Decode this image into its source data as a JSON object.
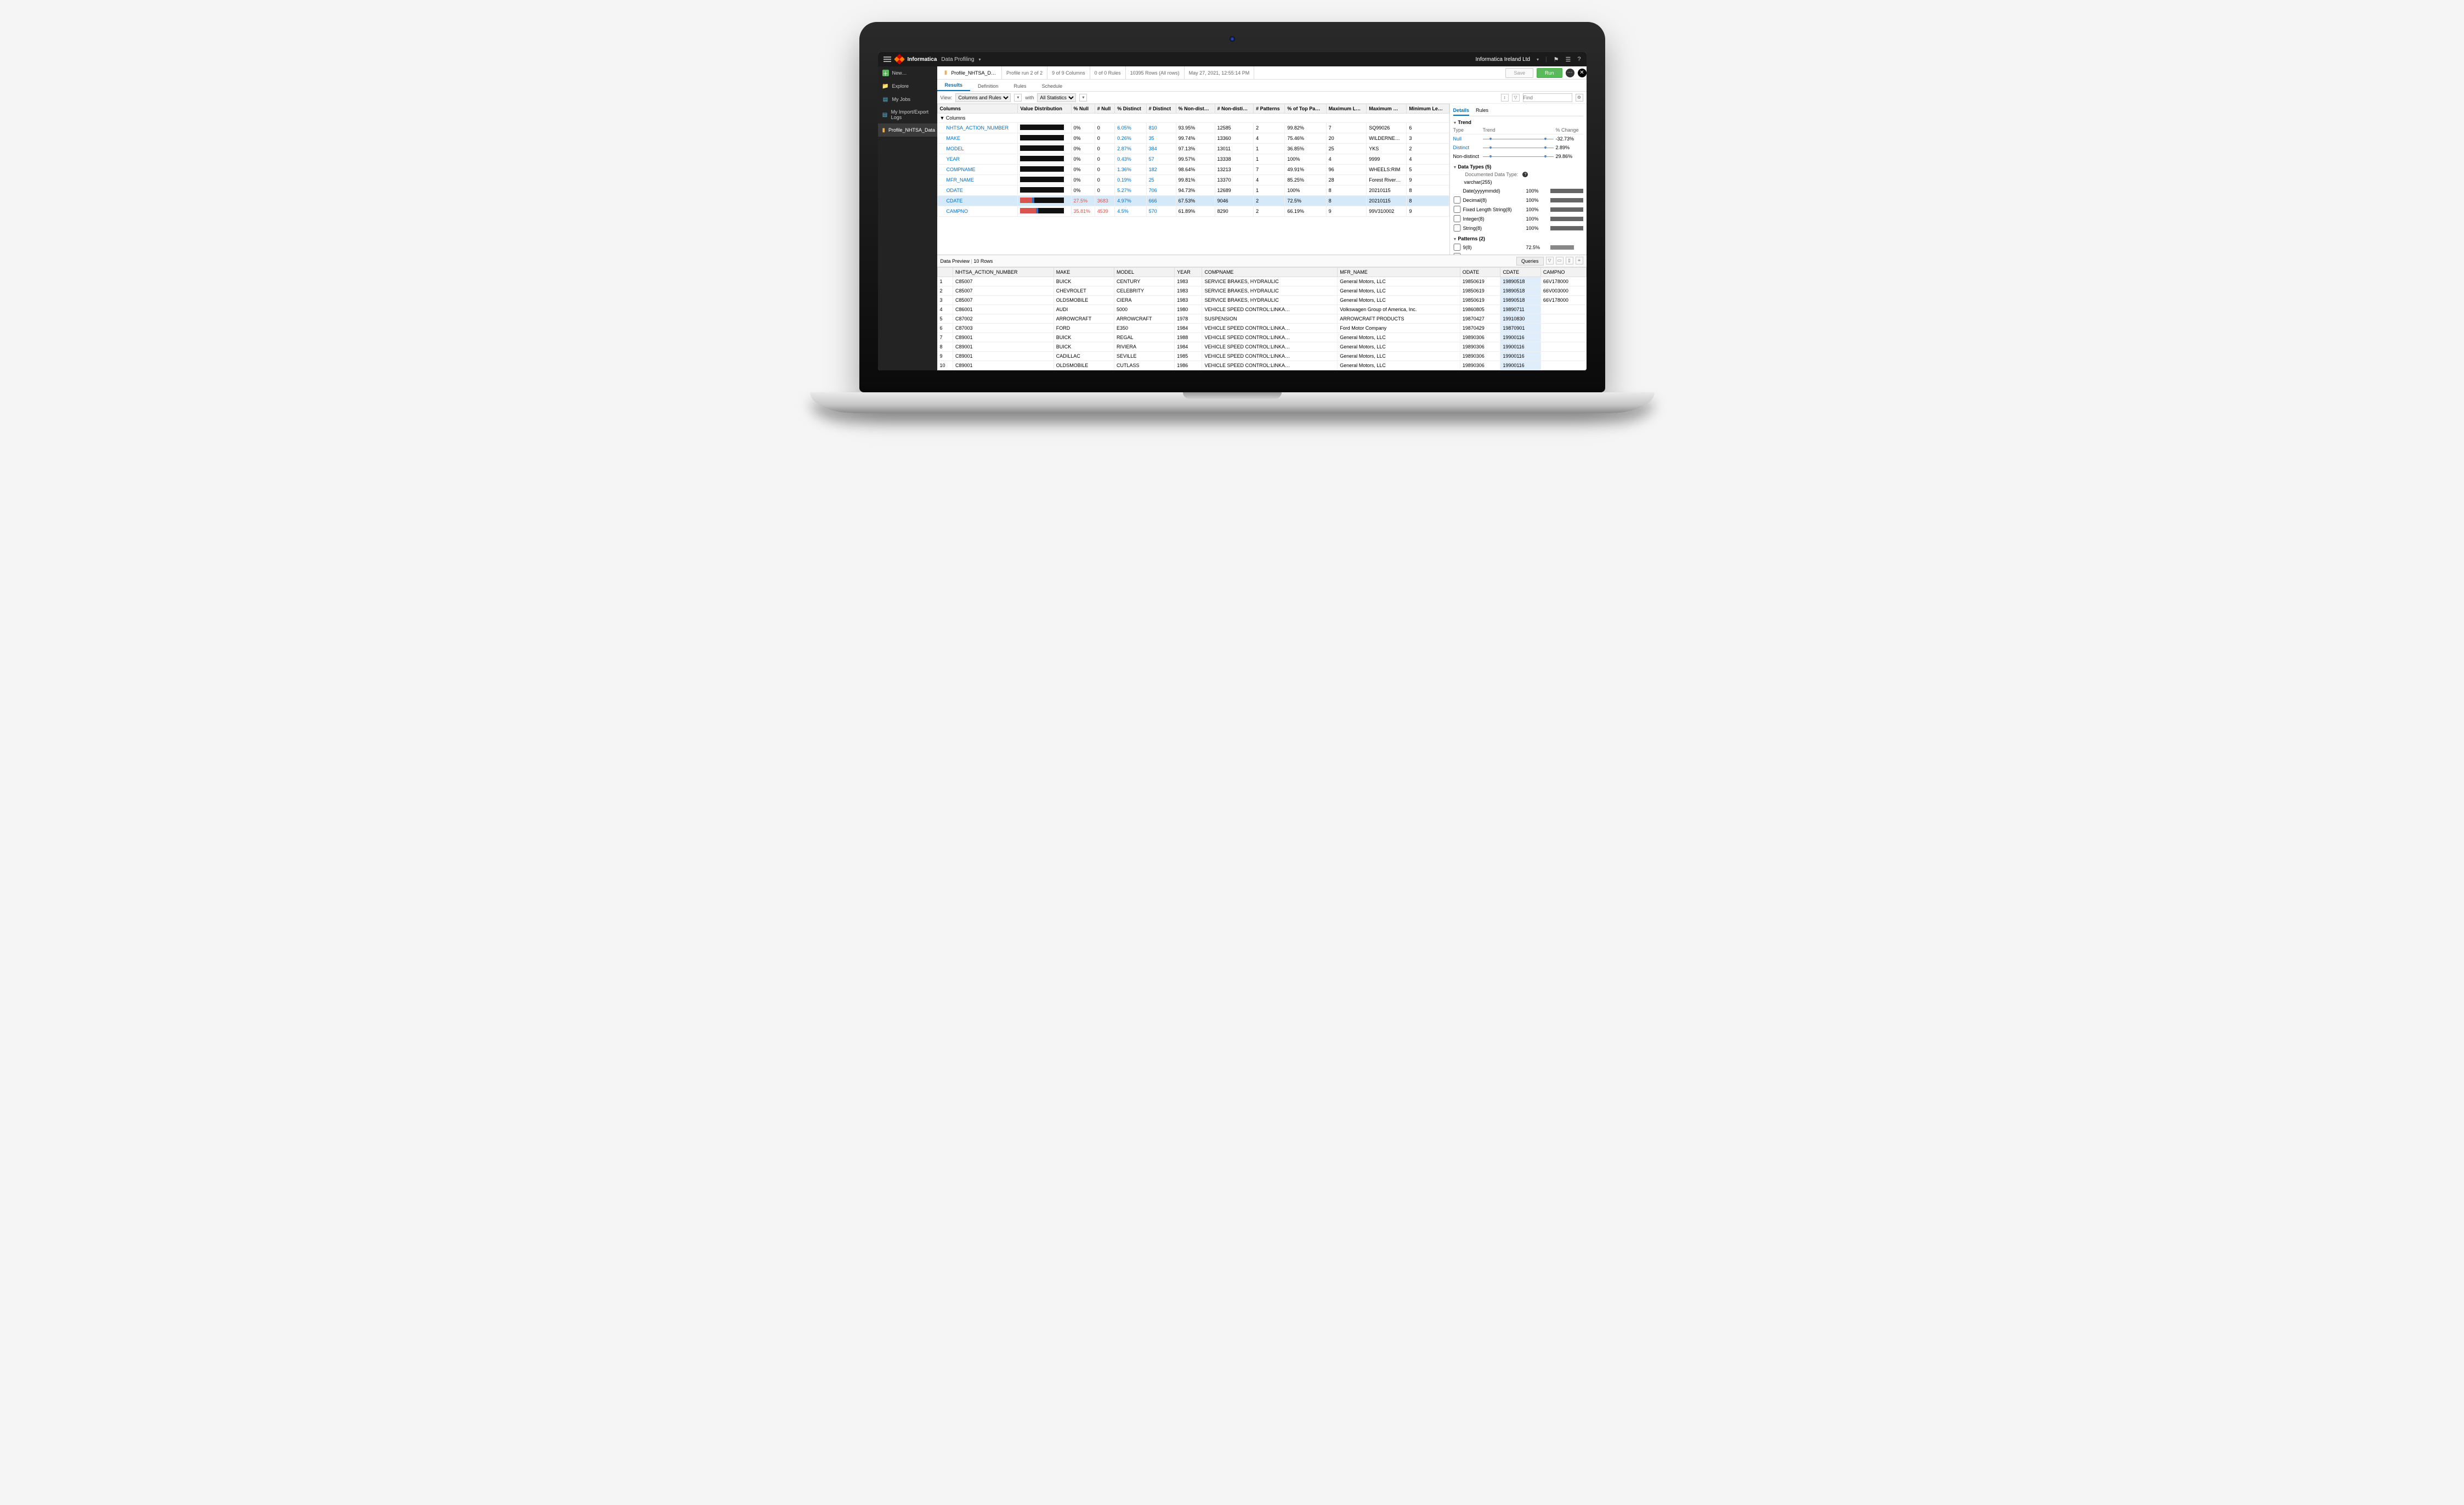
{
  "topbar": {
    "brand": "Informatica",
    "product": "Data Profiling",
    "org": "Informatica Ireland Ltd"
  },
  "sidebar": {
    "items": [
      {
        "icon": "new",
        "label": "New…"
      },
      {
        "icon": "folder",
        "label": "Explore"
      },
      {
        "icon": "doc",
        "label": "My Jobs"
      },
      {
        "icon": "doc",
        "label": "My Import/Export Logs"
      },
      {
        "icon": "chart",
        "label": "Profile_NHTSA_Data",
        "active": true,
        "close": true
      }
    ]
  },
  "tabrow": {
    "title": "Profile_NHTSA_D…",
    "status": [
      "Profile run 2 of 2",
      "9 of 9 Columns",
      "0 of 0 Rules",
      "10395 Rows (All rows)",
      "May 27, 2021, 12:55:14 PM"
    ],
    "save": "Save",
    "run": "Run"
  },
  "subtabs": [
    "Results",
    "Definition",
    "Rules",
    "Schedule"
  ],
  "filter": {
    "viewLabel": "View:",
    "view": "Columns and Rules",
    "withLabel": "with",
    "stats": "All Statistics",
    "find": "Find"
  },
  "gridHeaders": [
    "Columns",
    "Value Distribution",
    "% Null",
    "# Null",
    "% Distinct",
    "# Distinct",
    "% Non-dist…",
    "# Non-disti…",
    "# Patterns",
    "% of Top Pa…",
    "Maximum L…",
    "Maximum …",
    "Minimum Le…"
  ],
  "gridGroupLabel": "Columns",
  "gridRows": [
    {
      "name": "NHTSA_ACTION_NUMBER",
      "pctNull": "0%",
      "nNull": "0",
      "pctDist": "6.05%",
      "nDist": "810",
      "pctNon": "93.95%",
      "nNon": "12585",
      "nPat": "2",
      "pctTop": "99.82%",
      "maxL": "7",
      "maxV": "SQ99026",
      "minL": "6"
    },
    {
      "name": "MAKE",
      "pctNull": "0%",
      "nNull": "0",
      "pctDist": "0.26%",
      "nDist": "35",
      "pctNon": "99.74%",
      "nNon": "13360",
      "nPat": "4",
      "pctTop": "75.46%",
      "maxL": "20",
      "maxV": "WILDERNE…",
      "minL": "3"
    },
    {
      "name": "MODEL",
      "pctNull": "0%",
      "nNull": "0",
      "pctDist": "2.87%",
      "nDist": "384",
      "pctNon": "97.13%",
      "nNon": "13011",
      "nPat": "1",
      "pctTop": "36.85%",
      "maxL": "25",
      "maxV": "YKS",
      "minL": "2"
    },
    {
      "name": "YEAR",
      "pctNull": "0%",
      "nNull": "0",
      "pctDist": "0.43%",
      "nDist": "57",
      "pctNon": "99.57%",
      "nNon": "13338",
      "nPat": "1",
      "pctTop": "100%",
      "maxL": "4",
      "maxV": "9999",
      "minL": "4"
    },
    {
      "name": "COMPNAME",
      "pctNull": "0%",
      "nNull": "0",
      "pctDist": "1.36%",
      "nDist": "182",
      "pctNon": "98.64%",
      "nNon": "13213",
      "nPat": "7",
      "pctTop": "49.91%",
      "maxL": "96",
      "maxV": "WHEELS:RIM",
      "minL": "5"
    },
    {
      "name": "MFR_NAME",
      "pctNull": "0%",
      "nNull": "0",
      "pctDist": "0.19%",
      "nDist": "25",
      "pctNon": "99.81%",
      "nNon": "13370",
      "nPat": "4",
      "pctTop": "85.25%",
      "maxL": "28",
      "maxV": "Forest River…",
      "minL": "9"
    },
    {
      "name": "ODATE",
      "pctNull": "0%",
      "nNull": "0",
      "pctDist": "5.27%",
      "nDist": "706",
      "pctNon": "94.73%",
      "nNon": "12689",
      "nPat": "1",
      "pctTop": "100%",
      "maxL": "8",
      "maxV": "20210115",
      "minL": "8"
    },
    {
      "name": "CDATE",
      "sel": true,
      "red": true,
      "pctNull": "27.5%",
      "nNull": "3683",
      "pctDist": "4.97%",
      "nDist": "666",
      "pctNon": "67.53%",
      "nNon": "9046",
      "nPat": "2",
      "pctTop": "72.5%",
      "maxL": "8",
      "maxV": "20210115",
      "minL": "8",
      "distRed": 27.5,
      "distBlue": 5
    },
    {
      "name": "CAMPNO",
      "red": true,
      "pctNull": "35.81%",
      "nNull": "4539",
      "pctDist": "4.5%",
      "nDist": "570",
      "pctNon": "61.89%",
      "nNon": "8290",
      "nPat": "2",
      "pctTop": "66.19%",
      "maxL": "9",
      "maxV": "99V310002",
      "minL": "9",
      "distRed": 35.8,
      "distBlue": 4.5
    }
  ],
  "details": {
    "tabs": [
      "Details",
      "Rules"
    ],
    "trendTitle": "Trend",
    "trendHead": [
      "Type",
      "Trend",
      "% Change"
    ],
    "trendRows": [
      {
        "type": "Null",
        "change": "-32.73%",
        "link": true
      },
      {
        "type": "Distinct",
        "change": "2.89%",
        "link": true
      },
      {
        "type": "Non-distinct",
        "change": "29.86%"
      }
    ],
    "dataTypesTitle": "Data Types (5)",
    "docLabel": "Documented Data Type:",
    "dataTypes": [
      {
        "name": "varchar(255)",
        "pct": "",
        "doc": true
      },
      {
        "name": "Date(yyyymmdd)",
        "pct": "100%"
      },
      {
        "name": "Decimal(8)",
        "pct": "100%",
        "chk": true
      },
      {
        "name": "Fixed Length String(8)",
        "pct": "100%",
        "chk": true
      },
      {
        "name": "Integer(8)",
        "pct": "100%",
        "chk": true
      },
      {
        "name": "String(8)",
        "pct": "100%",
        "chk": true
      }
    ],
    "patternsTitle": "Patterns (2)",
    "patterns": [
      {
        "name": "9(8)",
        "pct": "72.5%",
        "w": 72
      },
      {
        "name": "null",
        "pct": "",
        "w": 28
      }
    ]
  },
  "preview": {
    "title": "Data Preview",
    "count": "10 Rows",
    "queries": "Queries",
    "headers": [
      "",
      "NHTSA_ACTION_NUMBER",
      "MAKE",
      "MODEL",
      "YEAR",
      "COMPNAME",
      "MFR_NAME",
      "ODATE",
      "CDATE",
      "CAMPNO"
    ],
    "hlCol": 8,
    "rows": [
      [
        "1",
        "C85007",
        "BUICK",
        "CENTURY",
        "1983",
        "SERVICE BRAKES, HYDRAULIC",
        "General Motors, LLC",
        "19850619",
        "19890518",
        "66V178000"
      ],
      [
        "2",
        "C85007",
        "CHEVROLET",
        "CELEBRITY",
        "1983",
        "SERVICE BRAKES, HYDRAULIC",
        "General Motors, LLC",
        "19850619",
        "19890518",
        "66V003000"
      ],
      [
        "3",
        "C85007",
        "OLDSMOBILE",
        "CIERA",
        "1983",
        "SERVICE BRAKES, HYDRAULIC",
        "General Motors, LLC",
        "19850619",
        "19890518",
        "66V178000"
      ],
      [
        "4",
        "C86001",
        "AUDI",
        "5000",
        "1980",
        "VEHICLE SPEED CONTROL:LINKA…",
        "Volkswagen Group of America, Inc.",
        "19860805",
        "19890711",
        ""
      ],
      [
        "5",
        "C87002",
        "ARROWCRAFT",
        "ARROWCRAFT",
        "1978",
        "SUSPENSION",
        "ARROWCRAFT PRODUCTS",
        "19870427",
        "19910830",
        ""
      ],
      [
        "6",
        "C87003",
        "FORD",
        "E350",
        "1984",
        "VEHICLE SPEED CONTROL:LINKA…",
        "Ford Motor Company",
        "19870429",
        "19870901",
        ""
      ],
      [
        "7",
        "C89001",
        "BUICK",
        "REGAL",
        "1988",
        "VEHICLE SPEED CONTROL:LINKA…",
        "General Motors, LLC",
        "19890306",
        "19900116",
        ""
      ],
      [
        "8",
        "C89001",
        "BUICK",
        "RIVIERA",
        "1984",
        "VEHICLE SPEED CONTROL:LINKA…",
        "General Motors, LLC",
        "19890306",
        "19900116",
        ""
      ],
      [
        "9",
        "C89001",
        "CADILLAC",
        "SEVILLE",
        "1985",
        "VEHICLE SPEED CONTROL:LINKA…",
        "General Motors, LLC",
        "19890306",
        "19900116",
        ""
      ],
      [
        "10",
        "C89001",
        "OLDSMOBILE",
        "CUTLASS",
        "1986",
        "VEHICLE SPEED CONTROL:LINKA…",
        "General Motors, LLC",
        "19890306",
        "19900116",
        ""
      ]
    ]
  }
}
